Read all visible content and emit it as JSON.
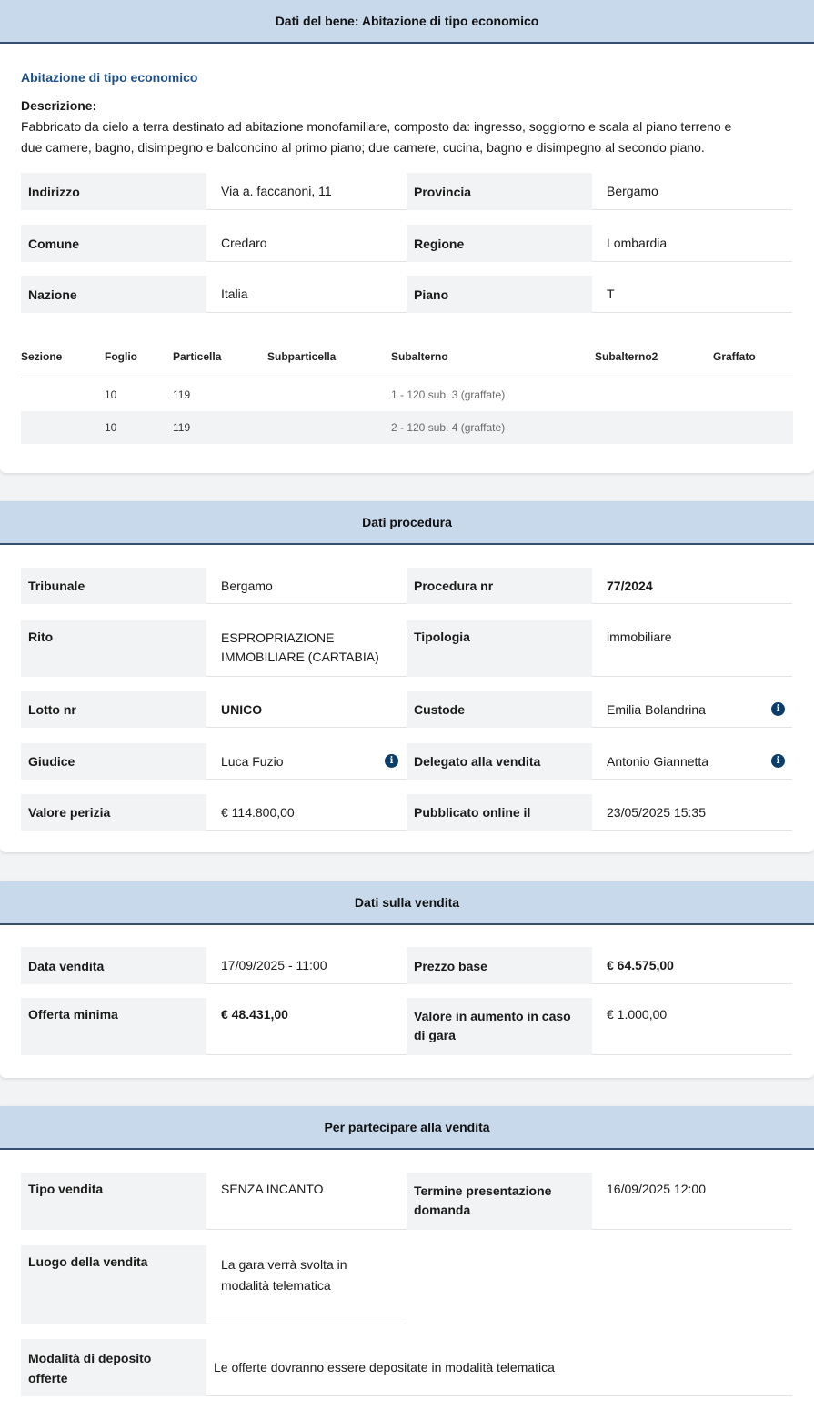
{
  "bene": {
    "header": "Dati del bene: Abitazione di tipo economico",
    "title": "Abitazione di tipo economico",
    "desc_label": "Descrizione:",
    "desc_line1": "Fabbricato da cielo a terra destinato ad abitazione monofamiliare, composto da: ingresso, soggiorno e scala al piano terreno e",
    "desc_line2": "due camere, bagno, disimpegno e balconcino al primo piano; due camere, cucina, bagno e disimpegno al secondo piano.",
    "indirizzo_label": "Indirizzo",
    "indirizzo": "Via a. faccanoni, 11",
    "provincia_label": "Provincia",
    "provincia": "Bergamo",
    "comune_label": "Comune",
    "comune": "Credaro",
    "regione_label": "Regione",
    "regione": "Lombardia",
    "nazione_label": "Nazione",
    "nazione": "Italia",
    "piano_label": "Piano",
    "piano": "T",
    "table": {
      "headers": [
        "Sezione",
        "Foglio",
        "Particella",
        "Subparticella",
        "Subalterno",
        "Subalterno2",
        "Graffato"
      ],
      "rows": [
        {
          "foglio": "10",
          "particella": "119",
          "subalterno": "1 - 120 sub. 3 (graffate)"
        },
        {
          "foglio": "10",
          "particella": "119",
          "subalterno": "2 - 120 sub. 4 (graffate)"
        }
      ]
    }
  },
  "procedura": {
    "header": "Dati procedura",
    "tribunale_label": "Tribunale",
    "tribunale": "Bergamo",
    "procedura_label": "Procedura nr",
    "procedura": "77/2024",
    "rito_label": "Rito",
    "rito_line1": "ESPROPRIAZIONE",
    "rito_line2": "IMMOBILIARE (CARTABIA)",
    "tipologia_label": "Tipologia",
    "tipologia": "immobiliare",
    "lotto_label": "Lotto nr",
    "lotto": "UNICO",
    "custode_label": "Custode",
    "custode": "Emilia Bolandrina",
    "giudice_label": "Giudice",
    "giudice": "Luca Fuzio",
    "delegato_label": "Delegato alla vendita",
    "delegato": "Antonio Giannetta",
    "perizia_label": "Valore perizia",
    "perizia": "€ 114.800,00",
    "pubblicato_label": "Pubblicato online il",
    "pubblicato": "23/05/2025 15:35"
  },
  "vendita": {
    "header": "Dati sulla vendita",
    "data_label": "Data vendita",
    "data": "17/09/2025 - 11:00",
    "prezzo_label": "Prezzo base",
    "prezzo": "€ 64.575,00",
    "offerta_label": "Offerta minima",
    "offerta": "€ 48.431,00",
    "aumento_label_1": "Valore in aumento in caso",
    "aumento_label_2": "di gara",
    "aumento": "€ 1.000,00"
  },
  "partecipare": {
    "header": "Per partecipare alla vendita",
    "tipo_label": "Tipo vendita",
    "tipo": "SENZA INCANTO",
    "termine_label_1": "Termine presentazione",
    "termine_label_2": "domanda",
    "termine": "16/09/2025 12:00",
    "luogo_label": "Luogo della vendita",
    "luogo_line1": "La gara verrà svolta in",
    "luogo_line2": "modalità telematica",
    "deposito_label_1": "Modalità di deposito",
    "deposito_label_2": "offerte",
    "deposito": "Le offerte dovranno essere depositate in modalità telematica"
  },
  "icons": {
    "info": "info-icon",
    "info_glyph": "i"
  },
  "colors": {
    "header_bg": "#c8d9ec",
    "header_border": "#34506e",
    "title_blue": "#1c4f86",
    "label_bg": "#f2f3f4",
    "icon_blue": "#0b3d6b"
  }
}
